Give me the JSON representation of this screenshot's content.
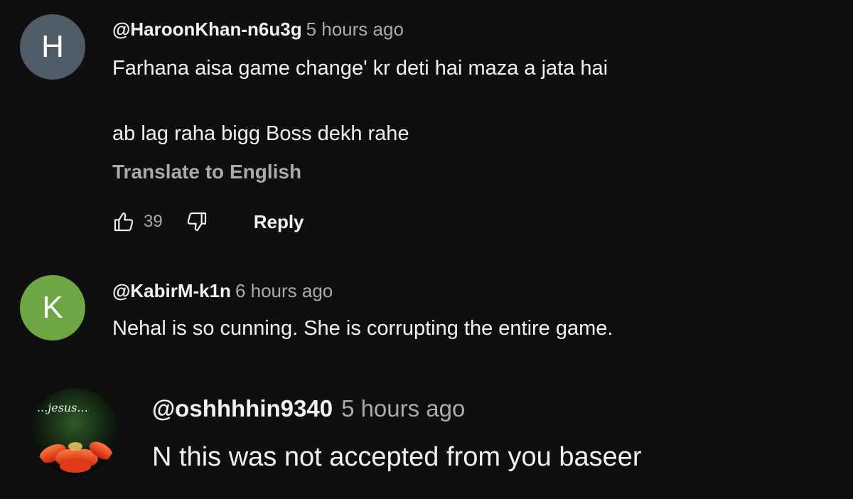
{
  "comments": [
    {
      "avatar_letter": "H",
      "avatar_color": "#4f5b67",
      "author": "@HaroonKhan-n6u3g",
      "time": "5 hours ago",
      "lines": [
        "Farhana aisa game change' kr deti hai maza a jata hai",
        "ab lag raha bigg Boss dekh rahe"
      ],
      "translate_label": "Translate to English",
      "likes": "39",
      "reply_label": "Reply"
    },
    {
      "avatar_letter": "K",
      "avatar_color": "#6fa645",
      "author": "@KabirM-k1n",
      "time": "6 hours ago",
      "lines": [
        "Nehal is so cunning. She is corrupting the entire game."
      ]
    }
  ],
  "overlay_comment": {
    "avatar_text": "...jesus...",
    "author": "@oshhhhin9340",
    "time": "5 hours ago",
    "lines": [
      "N this was not accepted from you baseer"
    ]
  },
  "icons": {
    "like": "thumb-up-icon",
    "dislike": "thumb-down-icon"
  }
}
